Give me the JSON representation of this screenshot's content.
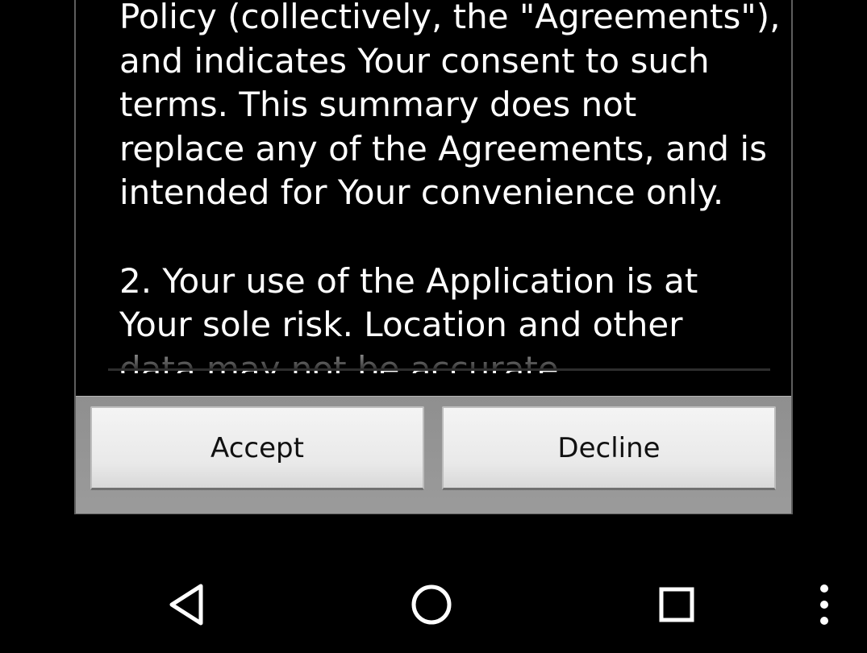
{
  "dialog": {
    "terms_text": "Policy (collectively, the \"Agreements\"),\nand indicates Your consent to such\nterms. This summary does not\nreplace any of the Agreements, and is\nintended for Your convenience only.\n\n2. Your use of the Application is at\nYour sole risk. Location and other\ndata may not be accurate",
    "accept_label": "Accept",
    "decline_label": "Decline"
  },
  "nav_bar": {
    "back_icon": "back-triangle-icon",
    "home_icon": "home-circle-icon",
    "recents_icon": "recents-square-icon",
    "menu_icon": "overflow-menu-icon"
  }
}
